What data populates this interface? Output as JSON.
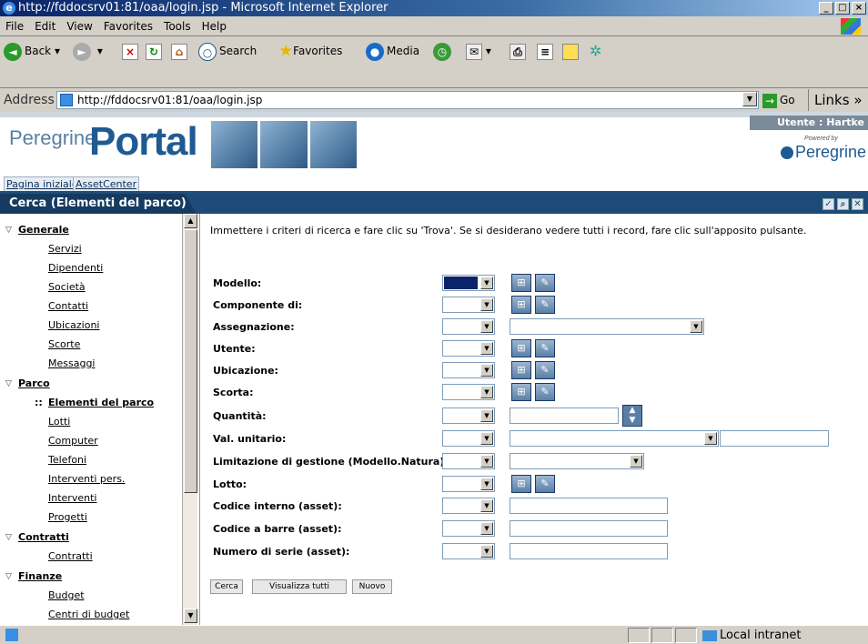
{
  "window": {
    "title": "http://fddocsrv01:81/oaa/login.jsp - Microsoft Internet Explorer"
  },
  "menu": [
    "File",
    "Edit",
    "View",
    "Favorites",
    "Tools",
    "Help"
  ],
  "toolbar": {
    "back": "Back",
    "search": "Search",
    "favorites": "Favorites",
    "media": "Media"
  },
  "address": {
    "label": "Address",
    "url": "http://fddocsrv01:81/oaa/login.jsp",
    "go": "Go",
    "links": "Links"
  },
  "header": {
    "brand_small": "Peregrine",
    "brand_big": "Portal",
    "user": "Utente : Hartke",
    "powered_by": "Powered by",
    "powered_brand": "Peregrine"
  },
  "tabs": [
    "Pagina iniziale",
    "AssetCenter"
  ],
  "section": {
    "title": "Cerca (Elementi del parco)"
  },
  "sidebar": {
    "generale": "Generale",
    "servizi": "Servizi",
    "dipendenti": "Dipendenti",
    "societa": "Società",
    "contatti": "Contatti",
    "ubicazioni": "Ubicazioni",
    "scorte": "Scorte",
    "messaggi": "Messaggi",
    "parco": "Parco",
    "elementi": "Elementi del parco",
    "lotti": "Lotti",
    "computer": "Computer",
    "telefoni": "Telefoni",
    "interventi_pers": "Interventi pers.",
    "interventi": "Interventi",
    "progetti": "Progetti",
    "contratti_cat": "Contratti",
    "contratti": "Contratti",
    "finanze": "Finanze",
    "budget": "Budget",
    "centri": "Centri di budget"
  },
  "form": {
    "intro": "Immettere i criteri di ricerca e fare clic su 'Trova'. Se si desiderano vedere tutti i record, fare clic sull'apposito pulsante.",
    "modello": "Modello:",
    "componente": "Componente di:",
    "assegnazione": "Assegnazione:",
    "utente": "Utente:",
    "ubicazione": "Ubicazione:",
    "scorta": "Scorta:",
    "quantita": "Quantità:",
    "val_unitario": "Val. unitario:",
    "limitazione": "Limitazione di gestione (Modello.Natura):",
    "lotto": "Lotto:",
    "codice_interno": "Codice interno (asset):",
    "codice_barre": "Codice a barre (asset):",
    "numero_serie": "Numero di serie (asset):"
  },
  "buttons": {
    "cerca": "Cerca",
    "visualizza": "Visualizza tutti",
    "nuovo": "Nuovo"
  },
  "status": {
    "zone": "Local intranet"
  }
}
